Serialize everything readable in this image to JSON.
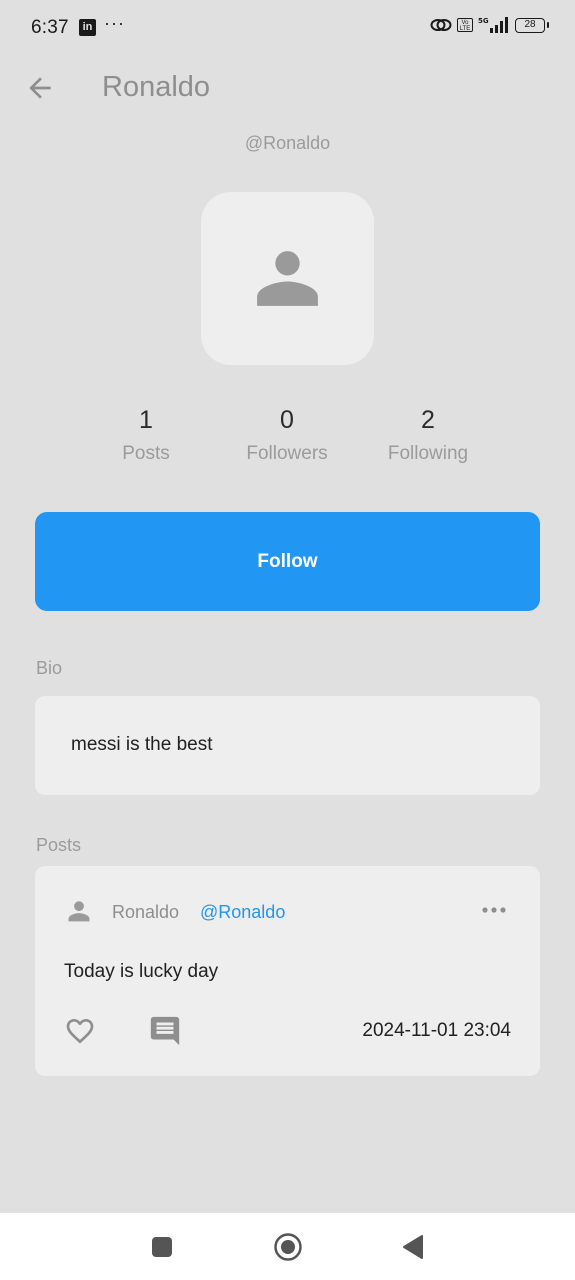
{
  "status_bar": {
    "time": "6:37",
    "notif_icon": "linkedin-icon",
    "battery": "28",
    "volte": "Vo LTE",
    "network": "5G"
  },
  "app_bar": {
    "title": "Ronaldo",
    "back_icon": "arrow-left-icon"
  },
  "profile": {
    "handle": "@Ronaldo",
    "avatar_icon": "person-icon",
    "stats": [
      {
        "value": "1",
        "label": "Posts"
      },
      {
        "value": "0",
        "label": "Followers"
      },
      {
        "value": "2",
        "label": "Following"
      }
    ],
    "follow_label": "Follow"
  },
  "bio": {
    "heading": "Bio",
    "text": "messi is the best"
  },
  "posts": {
    "heading": "Posts",
    "items": [
      {
        "author": "Ronaldo",
        "handle": "@Ronaldo",
        "body": "Today is lucky day",
        "date": "2024-11-01 23:04"
      }
    ]
  },
  "colors": {
    "background": "#e0e0e0",
    "accent": "#2196f3",
    "card": "#eeeeee"
  }
}
